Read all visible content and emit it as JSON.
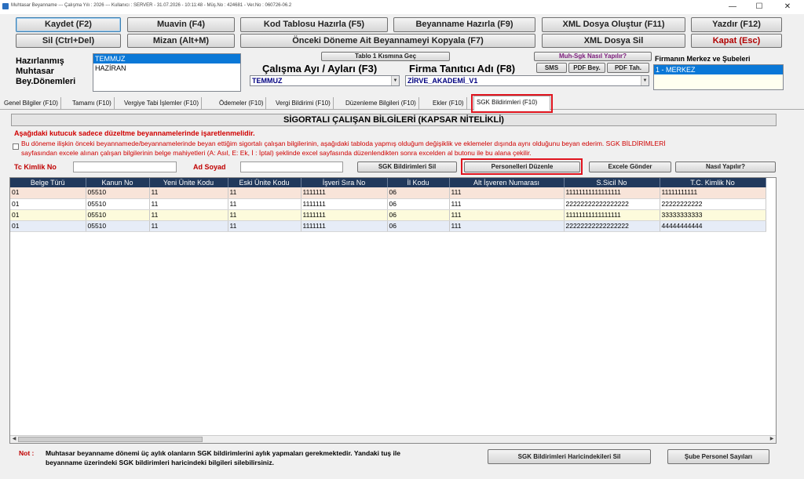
{
  "window": {
    "title": "Muhtasar Beyanname  ---  Çalışma Yılı : 2026  ---  Kullanıcı : SERVER - 31.07.2026 - 10:11:48  -  Müş.No : 424681  -  Ver.No : 060726-06.2",
    "minimize": "—",
    "maximize": "☐",
    "close": "✕"
  },
  "toolbar": {
    "row1": [
      "Kaydet (F2)",
      "Muavin (F4)",
      "Kod Tablosu Hazırla (F5)",
      "Beyanname Hazırla (F9)",
      "XML Dosya Oluştur (F11)",
      "Yazdır (F12)"
    ],
    "row2": [
      "Sil (Ctrl+Del)",
      "Mizan (Alt+M)",
      "Önceki Döneme Ait Beyannameyi Kopyala (F7)",
      "XML Dosya Sil",
      "Kapat (Esc)"
    ]
  },
  "periods": {
    "label_line1": "Hazırlanmış",
    "label_line2": "Muhtasar",
    "label_line3": "Bey.Dönemleri",
    "items": [
      "TEMMUZ",
      "HAZİRAN"
    ],
    "selected_index": 0
  },
  "work_month": {
    "tablo_button": "Tablo 1 Kısmına Geç",
    "label": "Çalışma Ayı / Ayları (F3)",
    "value": "TEMMUZ"
  },
  "firm": {
    "help_button": "Muh-Sgk Nasıl Yapılır?",
    "sms_button": "SMS",
    "pdf_bey_button": "PDF Bey.",
    "pdf_tah_button": "PDF Tah.",
    "label": "Firma Tanıtıcı Adı (F8)",
    "value": "ZİRVE_AKADEMİ_V1"
  },
  "branches": {
    "label": "Firmanın Merkez ve Şubeleri",
    "items": [
      "1 - MERKEZ"
    ]
  },
  "tabs": [
    "Genel Bilgiler (F10)",
    "Tamamı (F10)",
    "Vergiye Tabi İşlemler (F10)",
    "Ödemeler (F10)",
    "Vergi Bildirimi (F10)",
    "Düzenleme Bilgileri (F10)",
    "Ekler (F10)",
    "SGK Bildirimleri (F10)"
  ],
  "active_tab_index": 7,
  "section": {
    "title": "SİGORTALI ÇALIŞAN BİLGİLERİ (KAPSAR NİTELİKLİ)",
    "warning_title": "Aşağıdaki kutucuk sadece düzeltme beyannamelerinde işaretlenmelidir.",
    "warning_line1": "Bu döneme ilişkin önceki beyannamede/beyannamelerinde beyan ettiğim sigortalı çalışan bilgilerinin, aşağıdaki tabloda yapmış olduğum değişiklik ve eklemeler dışında aynı olduğunu beyan ederim. SGK BİLDİRİMLERİ",
    "warning_line2": "sayfasından excele alınan çalışan bilgilerinin belge mahiyetleri (A: Asıl, E: Ek, İ : İptal) şeklinde excel sayfasında düzenlendikten sonra excelden al butonu ile bu alana çekilir."
  },
  "filters": {
    "tc_label": "Tc Kimlik No",
    "tc_value": "",
    "name_label": "Ad Soyad",
    "name_value": "",
    "sgk_sil_button": "SGK Bildirimleri Sil",
    "personel_button": "Personelleri Düzenle",
    "excel_button": "Excele Gönder",
    "help_button": "Nasıl Yapılır?"
  },
  "table": {
    "columns": [
      "Belge Türü",
      "Kanun No",
      "Yeni Ünite Kodu",
      "Eski Ünite Kodu",
      "İşveri Sıra No",
      "İl Kodu",
      "Alt İşveren Numarası",
      "S.Sicil No",
      "T.C. Kimlik No"
    ],
    "rows": [
      [
        "01",
        "05510",
        "11",
        "11",
        "1111111",
        "06",
        "111",
        "11111111111111111",
        "11111111111"
      ],
      [
        "01",
        "05510",
        "11",
        "11",
        "1111111",
        "06",
        "111",
        "22222222222222222",
        "22222222222"
      ],
      [
        "01",
        "05510",
        "11",
        "11",
        "1111111",
        "06",
        "111",
        "11111111111111111",
        "33333333333"
      ],
      [
        "01",
        "05510",
        "11",
        "11",
        "1111111",
        "06",
        "111",
        "22222222222222222",
        "44444444444"
      ]
    ]
  },
  "footer": {
    "note_label": "Not :",
    "note_line1": "Muhtasar beyanname dönemi üç aylık olanların SGK bildirimlerini aylık yapmaları gerekmektedir. Yandaki tuş ile",
    "note_line2": "beyanname üzerindeki SGK bildirimleri haricindeki bilgileri silebilirsiniz.",
    "sgk_haric_button": "SGK Bildirimleri Haricindekileri Sil",
    "sube_button": "Şube Personel Sayıları"
  },
  "colors": {
    "grid_header": "#21395c",
    "highlight_box": "#e0141e",
    "selection": "#0a78d7",
    "warning_text": "#d00000"
  }
}
